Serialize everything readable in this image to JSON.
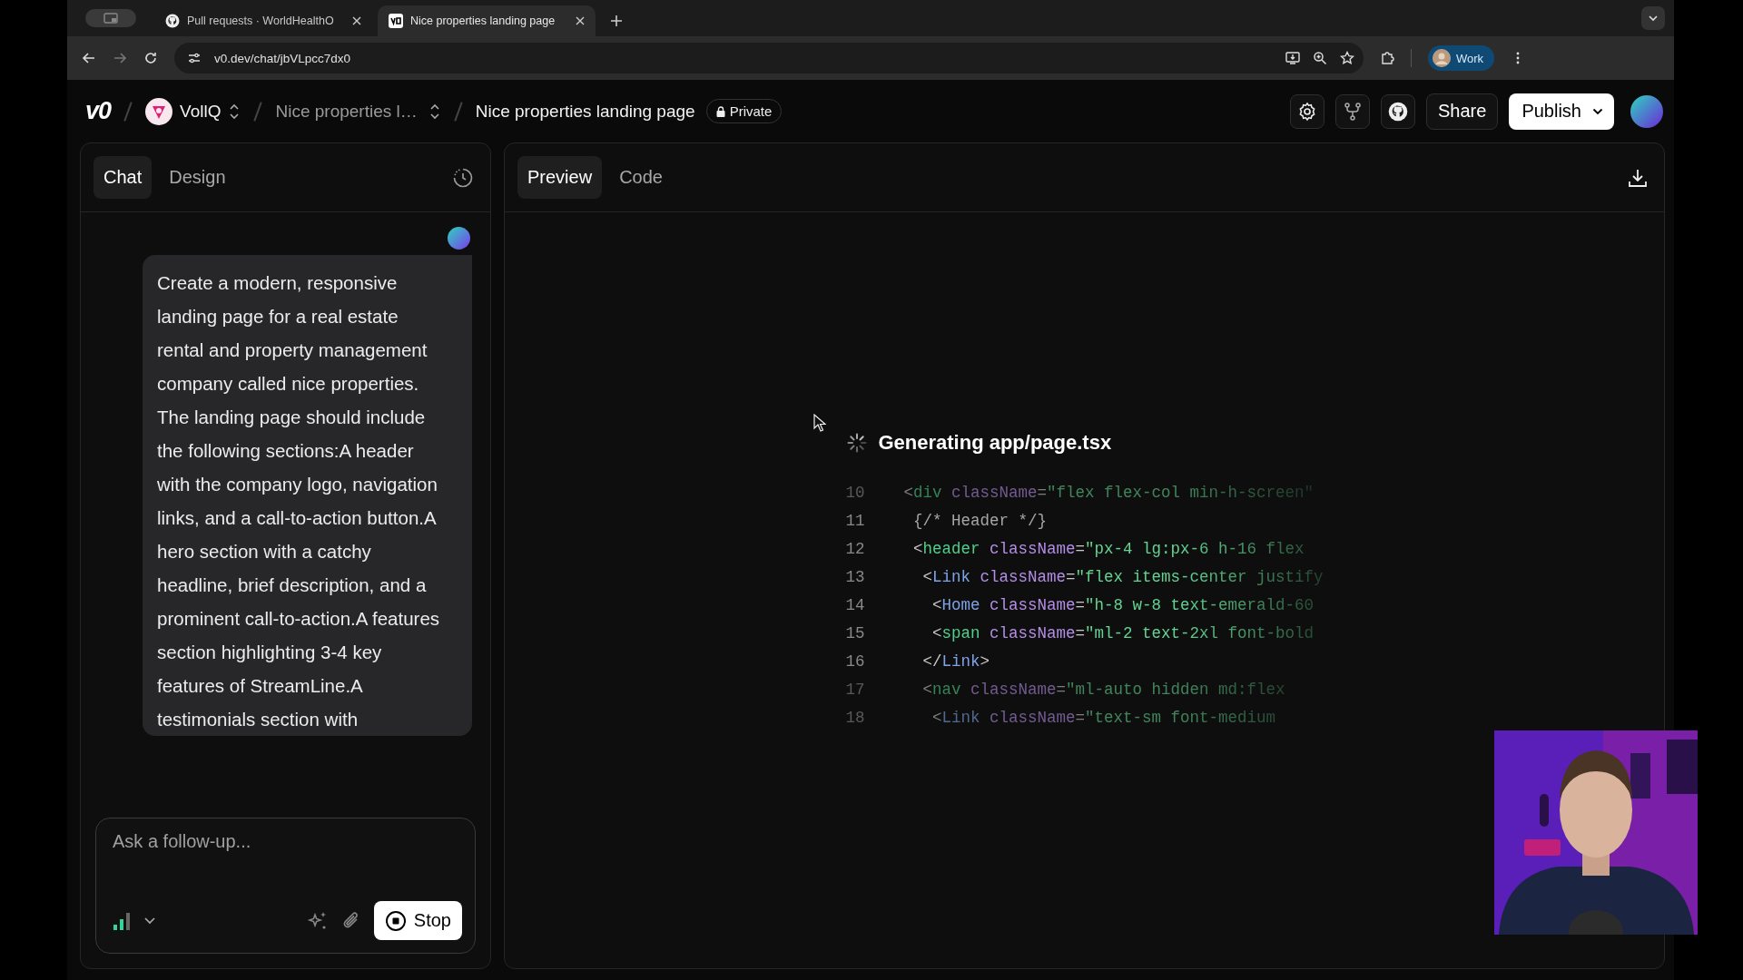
{
  "browser": {
    "tabs": [
      {
        "title": "Pull requests · WorldHealthO",
        "selected": false
      },
      {
        "title": "Nice properties landing page",
        "selected": true
      }
    ],
    "address": "v0.dev/chat/jbVLpcc7dx0",
    "profile": "Work"
  },
  "app_header": {
    "logo": "v0",
    "team": "VollQ",
    "project": "Nice properties l…",
    "chat_title": "Nice properties landing page",
    "visibility": "Private",
    "share_button": "Share",
    "publish_button": "Publish"
  },
  "chat_panel": {
    "tabs": [
      {
        "label": "Chat",
        "selected": true
      },
      {
        "label": "Design",
        "selected": false
      }
    ],
    "message": "Create a modern, responsive landing page for a real estate rental and property management company called nice properties. The landing page should include the following sections:A header with the company logo, navigation links, and a call-to-action button.A hero section with a catchy headline, brief description, and a prominent call-to-action.A features section highlighting 3-4 key features of StreamLine.A testimonials section with",
    "input": {
      "placeholder": "Ask a follow-up..."
    },
    "stop_button": "Stop"
  },
  "preview_panel": {
    "tabs": [
      {
        "label": "Preview",
        "selected": true
      },
      {
        "label": "Code",
        "selected": false
      }
    ],
    "status": "Generating app/page.tsx",
    "code_lines": [
      {
        "number": "10",
        "dimmed": true,
        "tokens": [
          {
            "text": "<",
            "kind": "punct"
          },
          {
            "text": "div",
            "kind": "tag"
          },
          {
            "text": " className",
            "kind": "attr"
          },
          {
            "text": "=",
            "kind": "punct"
          },
          {
            "text": "\"flex flex-col min-h-screen\"",
            "kind": "string"
          }
        ]
      },
      {
        "number": "11",
        "dimmed": false,
        "tokens": [
          {
            "text": " {/* Header */}",
            "kind": "comment"
          }
        ]
      },
      {
        "number": "12",
        "dimmed": false,
        "tokens": [
          {
            "text": " <",
            "kind": "punct"
          },
          {
            "text": "header",
            "kind": "tag"
          },
          {
            "text": " className",
            "kind": "attr"
          },
          {
            "text": "=",
            "kind": "punct"
          },
          {
            "text": "\"px-4 lg:px-6 h-16 flex",
            "kind": "string"
          }
        ]
      },
      {
        "number": "13",
        "dimmed": false,
        "tokens": [
          {
            "text": "  <",
            "kind": "punct"
          },
          {
            "text": "Link",
            "kind": "component"
          },
          {
            "text": " className",
            "kind": "attr"
          },
          {
            "text": "=",
            "kind": "punct"
          },
          {
            "text": "\"flex items-center justify",
            "kind": "string"
          }
        ]
      },
      {
        "number": "14",
        "dimmed": false,
        "tokens": [
          {
            "text": "   <",
            "kind": "punct"
          },
          {
            "text": "Home",
            "kind": "component"
          },
          {
            "text": " className",
            "kind": "attr"
          },
          {
            "text": "=",
            "kind": "punct"
          },
          {
            "text": "\"h-8 w-8 text-emerald-60",
            "kind": "string"
          }
        ]
      },
      {
        "number": "15",
        "dimmed": false,
        "tokens": [
          {
            "text": "   <",
            "kind": "punct"
          },
          {
            "text": "span",
            "kind": "tag"
          },
          {
            "text": " className",
            "kind": "attr"
          },
          {
            "text": "=",
            "kind": "punct"
          },
          {
            "text": "\"ml-2 text-2xl font-bold",
            "kind": "string"
          }
        ]
      },
      {
        "number": "16",
        "dimmed": false,
        "tokens": [
          {
            "text": "  </",
            "kind": "punct"
          },
          {
            "text": "Link",
            "kind": "component"
          },
          {
            "text": ">",
            "kind": "punct"
          }
        ]
      },
      {
        "number": "17",
        "dimmed": true,
        "tokens": [
          {
            "text": "  <",
            "kind": "punct"
          },
          {
            "text": "nav",
            "kind": "tag"
          },
          {
            "text": " className",
            "kind": "attr"
          },
          {
            "text": "=",
            "kind": "punct"
          },
          {
            "text": "\"ml-auto hidden md:flex",
            "kind": "string"
          }
        ]
      },
      {
        "number": "18",
        "dimmed": true,
        "tokens": [
          {
            "text": "   <",
            "kind": "punct"
          },
          {
            "text": "Link",
            "kind": "component"
          },
          {
            "text": " className",
            "kind": "attr"
          },
          {
            "text": "=",
            "kind": "punct"
          },
          {
            "text": "\"text-sm font-medium",
            "kind": "string"
          }
        ]
      }
    ]
  }
}
